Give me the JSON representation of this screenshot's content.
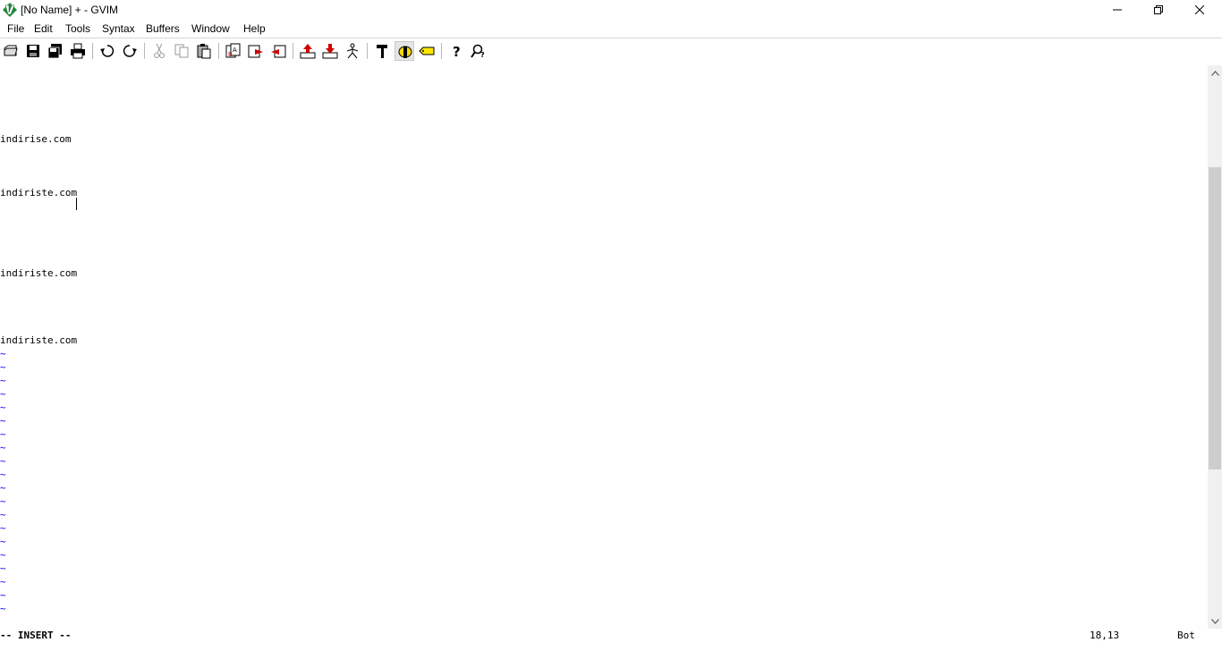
{
  "window": {
    "title": "[No Name] + - GVIM",
    "icon": "gvim-logo-icon"
  },
  "menu": [
    "File",
    "Edit",
    "Tools",
    "Syntax",
    "Buffers",
    "Window",
    "Help"
  ],
  "toolbar": [
    {
      "name": "open-file-icon"
    },
    {
      "name": "save-icon"
    },
    {
      "name": "save-all-icon"
    },
    {
      "name": "print-icon"
    },
    {
      "name": "undo-icon"
    },
    {
      "name": "redo-icon"
    },
    {
      "name": "cut-icon"
    },
    {
      "name": "copy-icon"
    },
    {
      "name": "paste-icon"
    },
    {
      "name": "replace-icon"
    },
    {
      "name": "find-next-icon"
    },
    {
      "name": "find-prev-icon"
    },
    {
      "name": "load-session-icon"
    },
    {
      "name": "save-session-icon"
    },
    {
      "name": "run-script-icon"
    },
    {
      "name": "make-icon"
    },
    {
      "name": "shell-icon"
    },
    {
      "name": "tag-jump-icon"
    },
    {
      "name": "help-icon"
    },
    {
      "name": "find-help-icon"
    }
  ],
  "editor": {
    "lines": [
      "indirise.com",
      "indiriste.com",
      "indiriste.com",
      "indiriste.com"
    ],
    "tilde": "~",
    "tilde_count": 20
  },
  "status": {
    "mode": "-- INSERT --",
    "position": "18,13",
    "scroll": "Bot"
  },
  "colors": {
    "tilde": "#0000ff",
    "background": "#ffffff"
  }
}
